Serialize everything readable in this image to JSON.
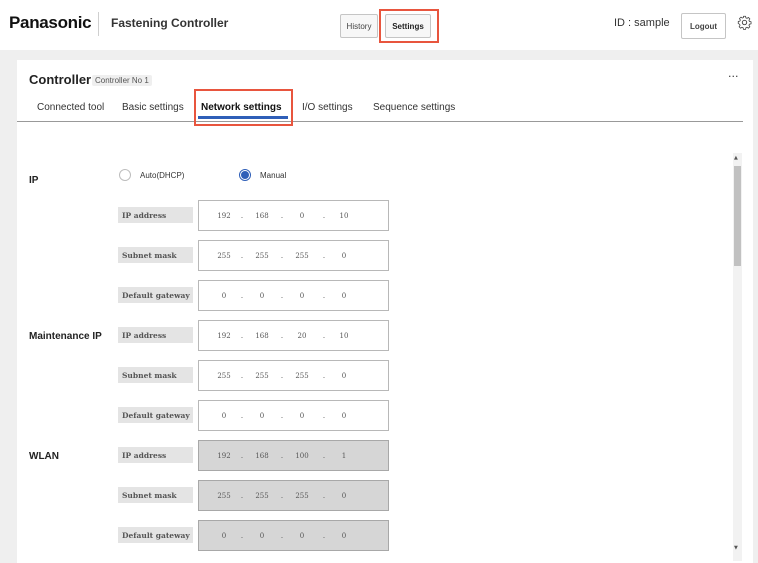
{
  "header": {
    "brand": "Panasonic",
    "app_title": "Fastening Controller",
    "history_label": "History",
    "settings_label": "Settings",
    "user_id": "ID : sample",
    "logout_label": "Logout"
  },
  "controller": {
    "title": "Controller",
    "subtitle": "Controller No 1",
    "more": "···"
  },
  "tabs": [
    {
      "label": "Connected tool"
    },
    {
      "label": "Basic settings"
    },
    {
      "label": "Network settings",
      "active": true
    },
    {
      "label": "I/O settings"
    },
    {
      "label": "Sequence settings"
    }
  ],
  "ip_mode": {
    "options": [
      {
        "label": "Auto(DHCP)",
        "selected": false
      },
      {
        "label": "Manual",
        "selected": true
      }
    ]
  },
  "sections": [
    {
      "label": "IP",
      "editable": true,
      "fields": [
        {
          "label": "IP address",
          "octets": [
            "192",
            "168",
            "0",
            "10"
          ]
        },
        {
          "label": "Subnet mask",
          "octets": [
            "255",
            "255",
            "255",
            "0"
          ]
        },
        {
          "label": "Default gateway",
          "octets": [
            "0",
            "0",
            "0",
            "0"
          ]
        }
      ]
    },
    {
      "label": "Maintenance IP",
      "editable": true,
      "fields": [
        {
          "label": "IP address",
          "octets": [
            "192",
            "168",
            "20",
            "10"
          ]
        },
        {
          "label": "Subnet mask",
          "octets": [
            "255",
            "255",
            "255",
            "0"
          ]
        },
        {
          "label": "Default gateway",
          "octets": [
            "0",
            "0",
            "0",
            "0"
          ]
        }
      ]
    },
    {
      "label": "WLAN",
      "editable": false,
      "fields": [
        {
          "label": "IP address",
          "octets": [
            "192",
            "168",
            "100",
            "1"
          ]
        },
        {
          "label": "Subnet mask",
          "octets": [
            "255",
            "255",
            "255",
            "0"
          ]
        },
        {
          "label": "Default gateway",
          "octets": [
            "0",
            "0",
            "0",
            "0"
          ]
        }
      ]
    }
  ],
  "colors": {
    "accent": "#2f5fb8",
    "highlight": "#e8553e",
    "disabled_field": "#d6d6d6"
  },
  "separator": "."
}
